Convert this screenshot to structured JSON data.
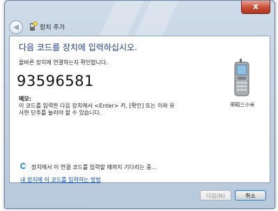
{
  "window": {
    "close_glyph": "x",
    "nav_title": "장치 추가",
    "back_glyph": "◀"
  },
  "content": {
    "heading": "다음 코드를 장치에 입력하십시오.",
    "subtext": "올바른 장치에 연결하는지 확인합니다.",
    "code": "93596581",
    "memo_label": "메모:",
    "memo_text": "이 코드를 입력한 다음 장치에서 <Enter> 키, [확인] 또는 이와 유사한 단추를 눌러야 할 수 있습니다.",
    "device_name": "邢昭三小米",
    "status": "장치에서 이 연결 코드를 입력할 때까지 기다리는 중...",
    "help_link": "내 장치에 이 코드를 입력하는 방법"
  },
  "footer": {
    "next_label": "다음(N)",
    "cancel_label": "취소"
  },
  "colors": {
    "heading": "#1f3d8a",
    "link": "#0046c8",
    "close_button": "#c74c35",
    "spinner": "#3b8fd9"
  },
  "icons": [
    "back-icon",
    "add-device-icon",
    "phone-icon",
    "close-icon",
    "spinner-icon"
  ]
}
